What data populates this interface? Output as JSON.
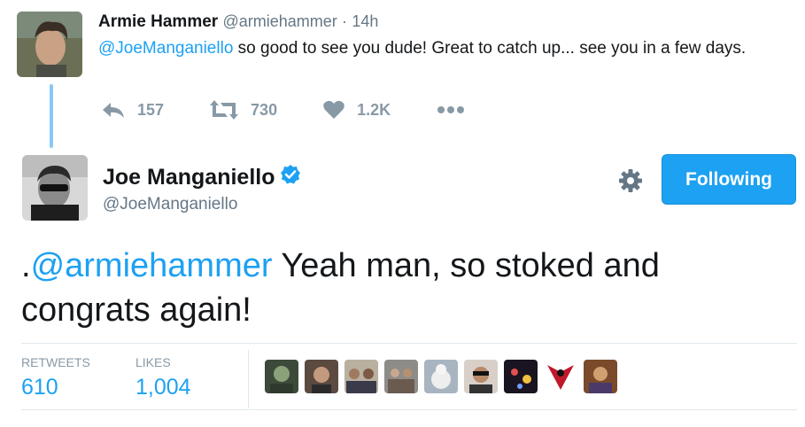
{
  "parent_tweet": {
    "name": "Armie Hammer",
    "handle": "@armiehammer",
    "time": "14h",
    "mention": "@JoeManganiello",
    "text": " so good to see you dude! Great to catch up... see you in a few days.",
    "replies": "157",
    "retweets": "730",
    "likes": "1.2K"
  },
  "main_tweet": {
    "name": "Joe Manganiello",
    "handle": "@JoeManganiello",
    "follow_label": "Following",
    "text_prefix": ".",
    "mention": "@armiehammer",
    "text": " Yeah man, so stoked and congrats again!",
    "retweets_label": "RETWEETS",
    "retweets_count": "610",
    "likes_label": "LIKES",
    "likes_count": "1,004"
  },
  "colors": {
    "accent": "#1da1f2",
    "muted": "#8899a6",
    "thread": "#88c9f9"
  },
  "icons": [
    "reply-icon",
    "retweet-icon",
    "heart-icon",
    "more-icon",
    "verified-icon",
    "gear-icon"
  ]
}
